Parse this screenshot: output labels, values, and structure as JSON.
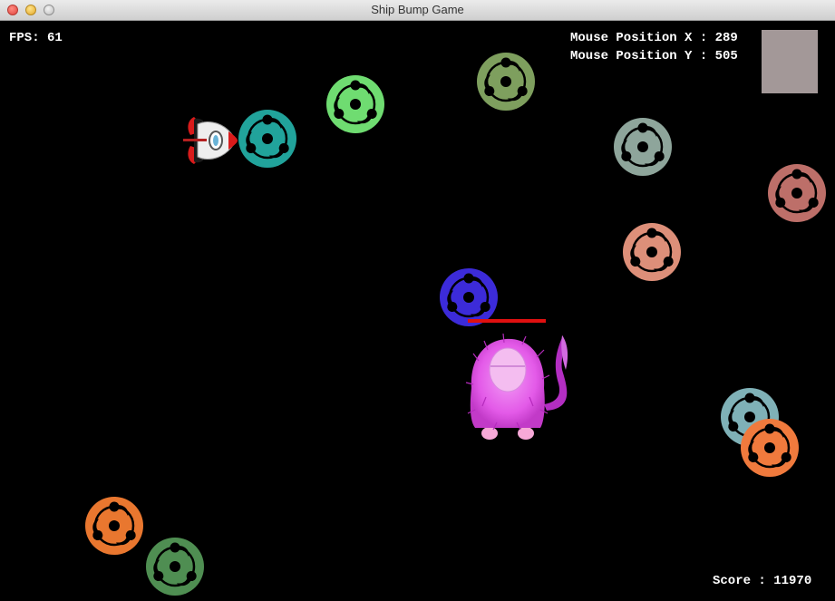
{
  "window": {
    "title": "Ship Bump Game"
  },
  "hud": {
    "fps_label": "FPS: 61",
    "mouse_x_label": "Mouse Position X : 289",
    "mouse_y_label": "Mouse Position Y : 505",
    "score_label": "Score : 11970",
    "swatch_color": "#a39898"
  },
  "tokens": [
    {
      "color": "#21a39b"
    },
    {
      "color": "#6fdc71"
    },
    {
      "color": "#7e9f5e"
    },
    {
      "color": "#8ea59b"
    },
    {
      "color": "#bd6f69"
    },
    {
      "color": "#dd8f79"
    },
    {
      "color": "#3c2bd9"
    },
    {
      "color": "#7fb1b7"
    },
    {
      "color": "#f07a3d"
    },
    {
      "color": "#e9772f"
    },
    {
      "color": "#4f8e52"
    }
  ],
  "colors": {
    "health_bar": "#e01010",
    "monster": "#e35ae8",
    "background": "#000000"
  },
  "icons": {
    "ship": "rocket-ship-icon",
    "monster": "pink-monster-icon",
    "token": "tomoe-disc-icon"
  }
}
